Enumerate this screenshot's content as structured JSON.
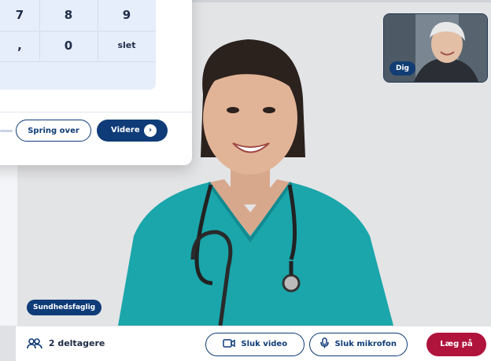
{
  "keypad": {
    "rows": [
      [
        {
          "label": "7"
        },
        {
          "label": "8"
        },
        {
          "label": "9"
        }
      ],
      [
        {
          "label": ","
        },
        {
          "label": "0"
        },
        {
          "label": "slet"
        }
      ]
    ]
  },
  "dialog": {
    "skip_label": "Spring over",
    "next_label": "Videre"
  },
  "video": {
    "remote_label": "Sundhedsfaglig",
    "self_label": "Dig"
  },
  "bottombar": {
    "participants_label": "2 deltagere",
    "video_label": "Sluk video",
    "mic_label": "Sluk mikrofon",
    "hangup_label": "Læg på"
  },
  "colors": {
    "primary": "#0f3c78",
    "hangup": "#b0143c",
    "keypad_bg": "#e7eefb"
  }
}
